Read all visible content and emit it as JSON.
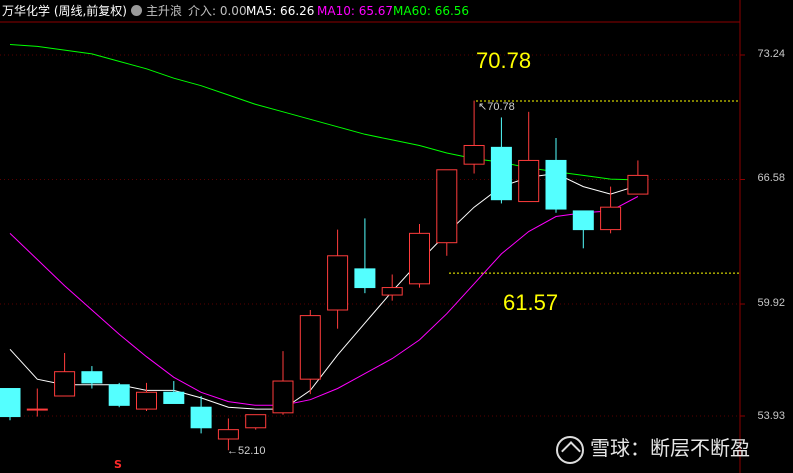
{
  "header": {
    "title": "万华化学 (周线,前复权)",
    "indicator": "主升浪",
    "entry": "介入: 0.00",
    "ma5": "MA5: 66.26",
    "ma10": "MA10: 65.67",
    "ma60": "MA60: 66.56",
    "colors": {
      "ma5": "#ffffff",
      "ma10": "#ff00ff",
      "ma60": "#00ff00",
      "title": "#ffffff",
      "text": "#c0c0c0"
    }
  },
  "annotations": {
    "high_big": "70.78",
    "low_big": "61.57",
    "high_small": "70.78",
    "low_small": "52.10",
    "bottom_mark": "S"
  },
  "price_axis": [
    "73.24",
    "66.58",
    "59.92",
    "53.93"
  ],
  "watermark": "雪球：断层不断盈",
  "chart_data": {
    "type": "candlestick",
    "y_ticks": [
      73.24,
      66.58,
      59.92,
      53.93
    ],
    "ylim": [
      51.0,
      74.5
    ],
    "candles": [
      {
        "o": 53.9,
        "c": 55.4,
        "h": 55.4,
        "l": 53.7,
        "up": false
      },
      {
        "o": 54.3,
        "c": 54.3,
        "h": 55.4,
        "l": 53.9,
        "up": true
      },
      {
        "o": 55.0,
        "c": 56.3,
        "h": 57.3,
        "l": 55.0,
        "up": true
      },
      {
        "o": 56.3,
        "c": 55.7,
        "h": 56.6,
        "l": 55.4,
        "up": false
      },
      {
        "o": 55.6,
        "c": 54.5,
        "h": 55.7,
        "l": 54.4,
        "up": false
      },
      {
        "o": 54.3,
        "c": 55.2,
        "h": 55.7,
        "l": 54.2,
        "up": true
      },
      {
        "o": 55.2,
        "c": 54.6,
        "h": 55.8,
        "l": 54.6,
        "up": false
      },
      {
        "o": 54.4,
        "c": 53.3,
        "h": 55.0,
        "l": 53.0,
        "up": false
      },
      {
        "o": 52.7,
        "c": 53.2,
        "h": 53.8,
        "l": 52.1,
        "up": true
      },
      {
        "o": 53.3,
        "c": 54.0,
        "h": 54.0,
        "l": 53.2,
        "up": true
      },
      {
        "o": 54.1,
        "c": 55.8,
        "h": 57.4,
        "l": 54.0,
        "up": true
      },
      {
        "o": 55.9,
        "c": 59.3,
        "h": 59.6,
        "l": 55.1,
        "up": true
      },
      {
        "o": 59.6,
        "c": 62.5,
        "h": 63.9,
        "l": 58.6,
        "up": true
      },
      {
        "o": 61.8,
        "c": 60.8,
        "h": 64.5,
        "l": 60.5,
        "up": false
      },
      {
        "o": 60.4,
        "c": 60.8,
        "h": 61.5,
        "l": 60.1,
        "up": true
      },
      {
        "o": 61.0,
        "c": 63.7,
        "h": 64.2,
        "l": 60.8,
        "up": true
      },
      {
        "o": 63.2,
        "c": 67.1,
        "h": 67.1,
        "l": 62.5,
        "up": true
      },
      {
        "o": 67.4,
        "c": 68.4,
        "h": 70.8,
        "l": 66.9,
        "up": true
      },
      {
        "o": 68.3,
        "c": 65.5,
        "h": 69.9,
        "l": 65.3,
        "up": false
      },
      {
        "o": 65.4,
        "c": 67.6,
        "h": 70.2,
        "l": 65.4,
        "up": true
      },
      {
        "o": 67.6,
        "c": 65.0,
        "h": 68.8,
        "l": 64.8,
        "up": false
      },
      {
        "o": 64.9,
        "c": 63.9,
        "h": 64.9,
        "l": 62.9,
        "up": false
      },
      {
        "o": 63.9,
        "c": 65.1,
        "h": 66.2,
        "l": 63.7,
        "up": true
      },
      {
        "o": 65.8,
        "c": 66.8,
        "h": 67.6,
        "l": 65.8,
        "up": true
      }
    ],
    "ma5": [
      57.5,
      55.9,
      55.6,
      55.6,
      55.6,
      55.3,
      55.3,
      54.9,
      54.4,
      54.3,
      54.3,
      55.3,
      57.2,
      58.9,
      60.6,
      62.2,
      63.7,
      65.1,
      66.2,
      66.7,
      66.9,
      66.2,
      65.8,
      66.26
    ],
    "ma10": [
      63.7,
      62.3,
      60.9,
      59.6,
      58.3,
      57.1,
      56.0,
      55.2,
      54.7,
      54.5,
      54.5,
      54.8,
      55.4,
      56.2,
      57.0,
      58.0,
      59.4,
      61.0,
      62.6,
      63.8,
      64.6,
      64.8,
      64.9,
      65.67
    ],
    "ma60": [
      73.8,
      73.7,
      73.5,
      73.3,
      72.9,
      72.5,
      72.0,
      71.6,
      71.1,
      70.6,
      70.2,
      69.8,
      69.4,
      69.0,
      68.7,
      68.4,
      68.0,
      67.7,
      67.5,
      67.2,
      67.0,
      66.8,
      66.6,
      66.56
    ],
    "high": 70.78,
    "low": 61.57,
    "low_marker": 52.1
  }
}
